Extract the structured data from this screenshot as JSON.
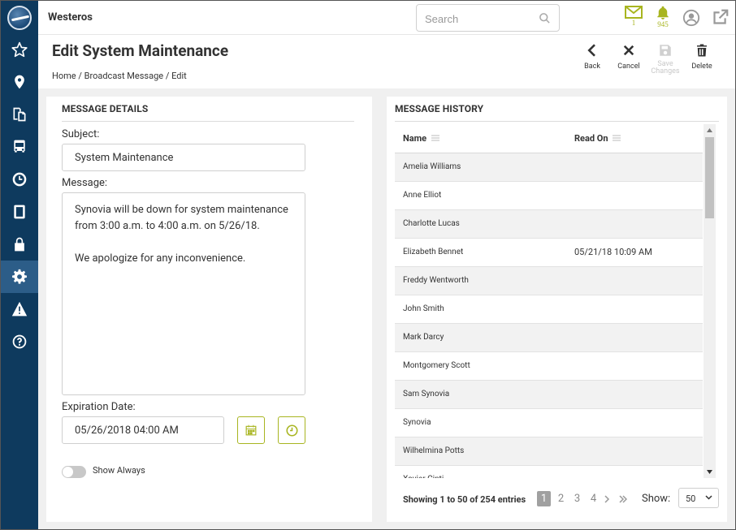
{
  "app": {
    "title": "Westeros"
  },
  "search": {
    "placeholder": "Search"
  },
  "notifications": {
    "messages_count": "1",
    "alerts_count": "945"
  },
  "header": {
    "title": "Edit System Maintenance"
  },
  "breadcrumb": [
    "Home",
    "Broadcast Message",
    "Edit"
  ],
  "toolbar": {
    "back": "Back",
    "cancel": "Cancel",
    "save_line1": "Save",
    "save_line2": "Changes",
    "delete": "Delete"
  },
  "details": {
    "title": "MESSAGE DETAILS",
    "subject_label": "Subject:",
    "subject_value": "System Maintenance",
    "message_label": "Message:",
    "message_lines": [
      "Synovia will be down for system maintenance",
      "from 3:00 a.m. to 4:00 a.m. on 5/26/18.",
      "",
      "We apologize for any inconvenience."
    ],
    "expiration_label": "Expiration Date:",
    "expiration_value": "05/26/2018 04:00 AM",
    "show_always_label": "Show Always",
    "show_always_on": false
  },
  "history": {
    "title": "MESSAGE HISTORY",
    "columns": [
      "Name",
      "Read On"
    ],
    "rows": [
      {
        "name": "Amelia Williams",
        "read_on": ""
      },
      {
        "name": "Anne Elliot",
        "read_on": ""
      },
      {
        "name": "Charlotte Lucas",
        "read_on": ""
      },
      {
        "name": "Elizabeth Bennet",
        "read_on": "05/21/18 10:09 AM"
      },
      {
        "name": "Freddy Wentworth",
        "read_on": ""
      },
      {
        "name": "John Smith",
        "read_on": ""
      },
      {
        "name": "Mark Darcy",
        "read_on": ""
      },
      {
        "name": "Montgomery Scott",
        "read_on": ""
      },
      {
        "name": "Sam Synovia",
        "read_on": ""
      },
      {
        "name": "Synovia",
        "read_on": ""
      },
      {
        "name": "Wilhelmina Potts",
        "read_on": ""
      },
      {
        "name": "Xavier Cinti",
        "read_on": ""
      }
    ],
    "entries_text": "Showing 1 to 50 of 254 entries",
    "pages": [
      "1",
      "2",
      "3",
      "4"
    ],
    "current_page": "1",
    "show_label": "Show:",
    "show_value": "50"
  },
  "colors": {
    "sidebar": "#0e3a5e",
    "accent": "#a8b520",
    "active_item": "#2c5d88"
  },
  "sidebar_icons": [
    "star-icon",
    "map-pin-icon",
    "documents-icon",
    "bus-icon",
    "clock-icon",
    "tablet-icon",
    "lock-icon",
    "gear-icon",
    "warning-icon",
    "help-icon"
  ]
}
